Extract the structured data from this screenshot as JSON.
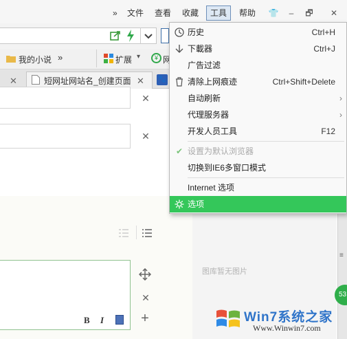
{
  "menubar": {
    "overflow": "»",
    "file": "文件",
    "view": "查看",
    "favorites": "收藏",
    "tools": "工具",
    "help": "帮助"
  },
  "bookmarks": {
    "novel": "我的小说",
    "more": "»",
    "extensions": "扩展",
    "net_partial": "网"
  },
  "tabs": [
    {
      "title": "短网址网站名_创建页面"
    }
  ],
  "tools_menu": {
    "items": [
      {
        "label": "历史",
        "shortcut": "Ctrl+H",
        "icon": "clock-icon"
      },
      {
        "label": "下載器",
        "shortcut": "Ctrl+J",
        "icon": "download-icon"
      },
      {
        "label": "广告过滤"
      },
      {
        "label": "清除上网痕迹",
        "shortcut": "Ctrl+Shift+Delete",
        "icon": "trash-icon"
      },
      {
        "label": "自动刷新",
        "submenu": true
      },
      {
        "label": "代理服务器",
        "submenu": true
      },
      {
        "label": "开发人员工具",
        "shortcut": "F12"
      },
      {
        "label": "设置为默认浏览器",
        "disabled": true,
        "icon": "check-icon"
      },
      {
        "label": "切换到IE6多窗口模式"
      },
      {
        "label": "Internet 选项"
      },
      {
        "label": "选项",
        "icon": "gear-icon",
        "highlighted": true
      }
    ]
  },
  "page": {
    "no_image": "图库暂无图片",
    "editor": {
      "bold": "B",
      "italic": "I"
    },
    "badge": "53"
  },
  "watermark": {
    "brand": "Win7系统之家",
    "url": "Www.Winwin7.com"
  },
  "colors": {
    "highlight": "#34c75a",
    "menu_bg": "#f9f9f9"
  }
}
